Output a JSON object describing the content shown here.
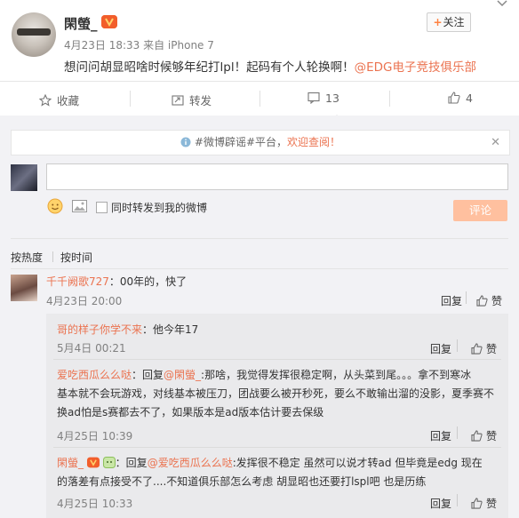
{
  "post": {
    "username": "閑螢_",
    "badge": "VIP",
    "meta": "4月23日 18:33 来自 iPhone 7",
    "follow_label": "关注",
    "follow_plus": "+",
    "content_text": "想问问胡显昭啥时候够年纪打lpl！起码有个人轮换啊！",
    "content_mention": "@EDG电子竞技俱乐部"
  },
  "actions": {
    "favorite": "收藏",
    "forward": "转发",
    "comment_count": "13",
    "like_count": "4"
  },
  "notice": {
    "hashtags": "#微博辟谣#平台，",
    "welcome": "欢迎查阅！",
    "close": "✕"
  },
  "composer": {
    "forward_checkbox_label": "同时转发到我的微博",
    "submit_label": "评论"
  },
  "sort": {
    "by_hot": "按热度",
    "by_time": "按时间"
  },
  "comments": [
    {
      "name": "千千阙歌727",
      "text": "：00年的，快了",
      "time": "4月23日 20:00",
      "reply_label": "回复",
      "like_label": "赞"
    }
  ],
  "replies": [
    {
      "name": "哥的样子你学不来",
      "text": "：他今年17",
      "time": "5月4日 00:21",
      "reply_label": "回复",
      "like_label": "赞"
    },
    {
      "name": "爱吃西瓜么么哒",
      "prefix": "：回复",
      "mention": "@閑螢_",
      "line1": ":那啥，我觉得发挥很稳定啊，从头菜到尾。。。拿不到寒冰",
      "line2": "基本就不会玩游戏，对线基本被压刀，团战要么被开秒死，要么不敢输出溜的没影，夏季赛不",
      "line3": "换ad怕是s赛都去不了，如果版本是ad版本估计要去保级",
      "time": "4月25日 10:39",
      "reply_label": "回复",
      "like_label": "赞"
    },
    {
      "name": "閑螢_",
      "prefix": "：回复",
      "mention": "@爱吃西瓜么么哒",
      "line1": ":发挥很不稳定 虽然可以说才转ad 但毕竟是edg 现在",
      "line2": "的落差有点接受不了....不知道俱乐部怎么考虑 胡显昭也还要打lspl吧 也是历练",
      "time": "4月25日 10:33",
      "reply_label": "回复",
      "like_label": "赞"
    }
  ],
  "colors": {
    "accent": "#eb7350",
    "submit": "#ffc09f",
    "badge": "#f25e2b"
  },
  "icons": [
    "chevron-down-icon",
    "star-icon",
    "forward-icon",
    "comment-icon",
    "thumb-up-icon",
    "info-icon",
    "emoji-icon",
    "image-icon",
    "close-icon"
  ]
}
